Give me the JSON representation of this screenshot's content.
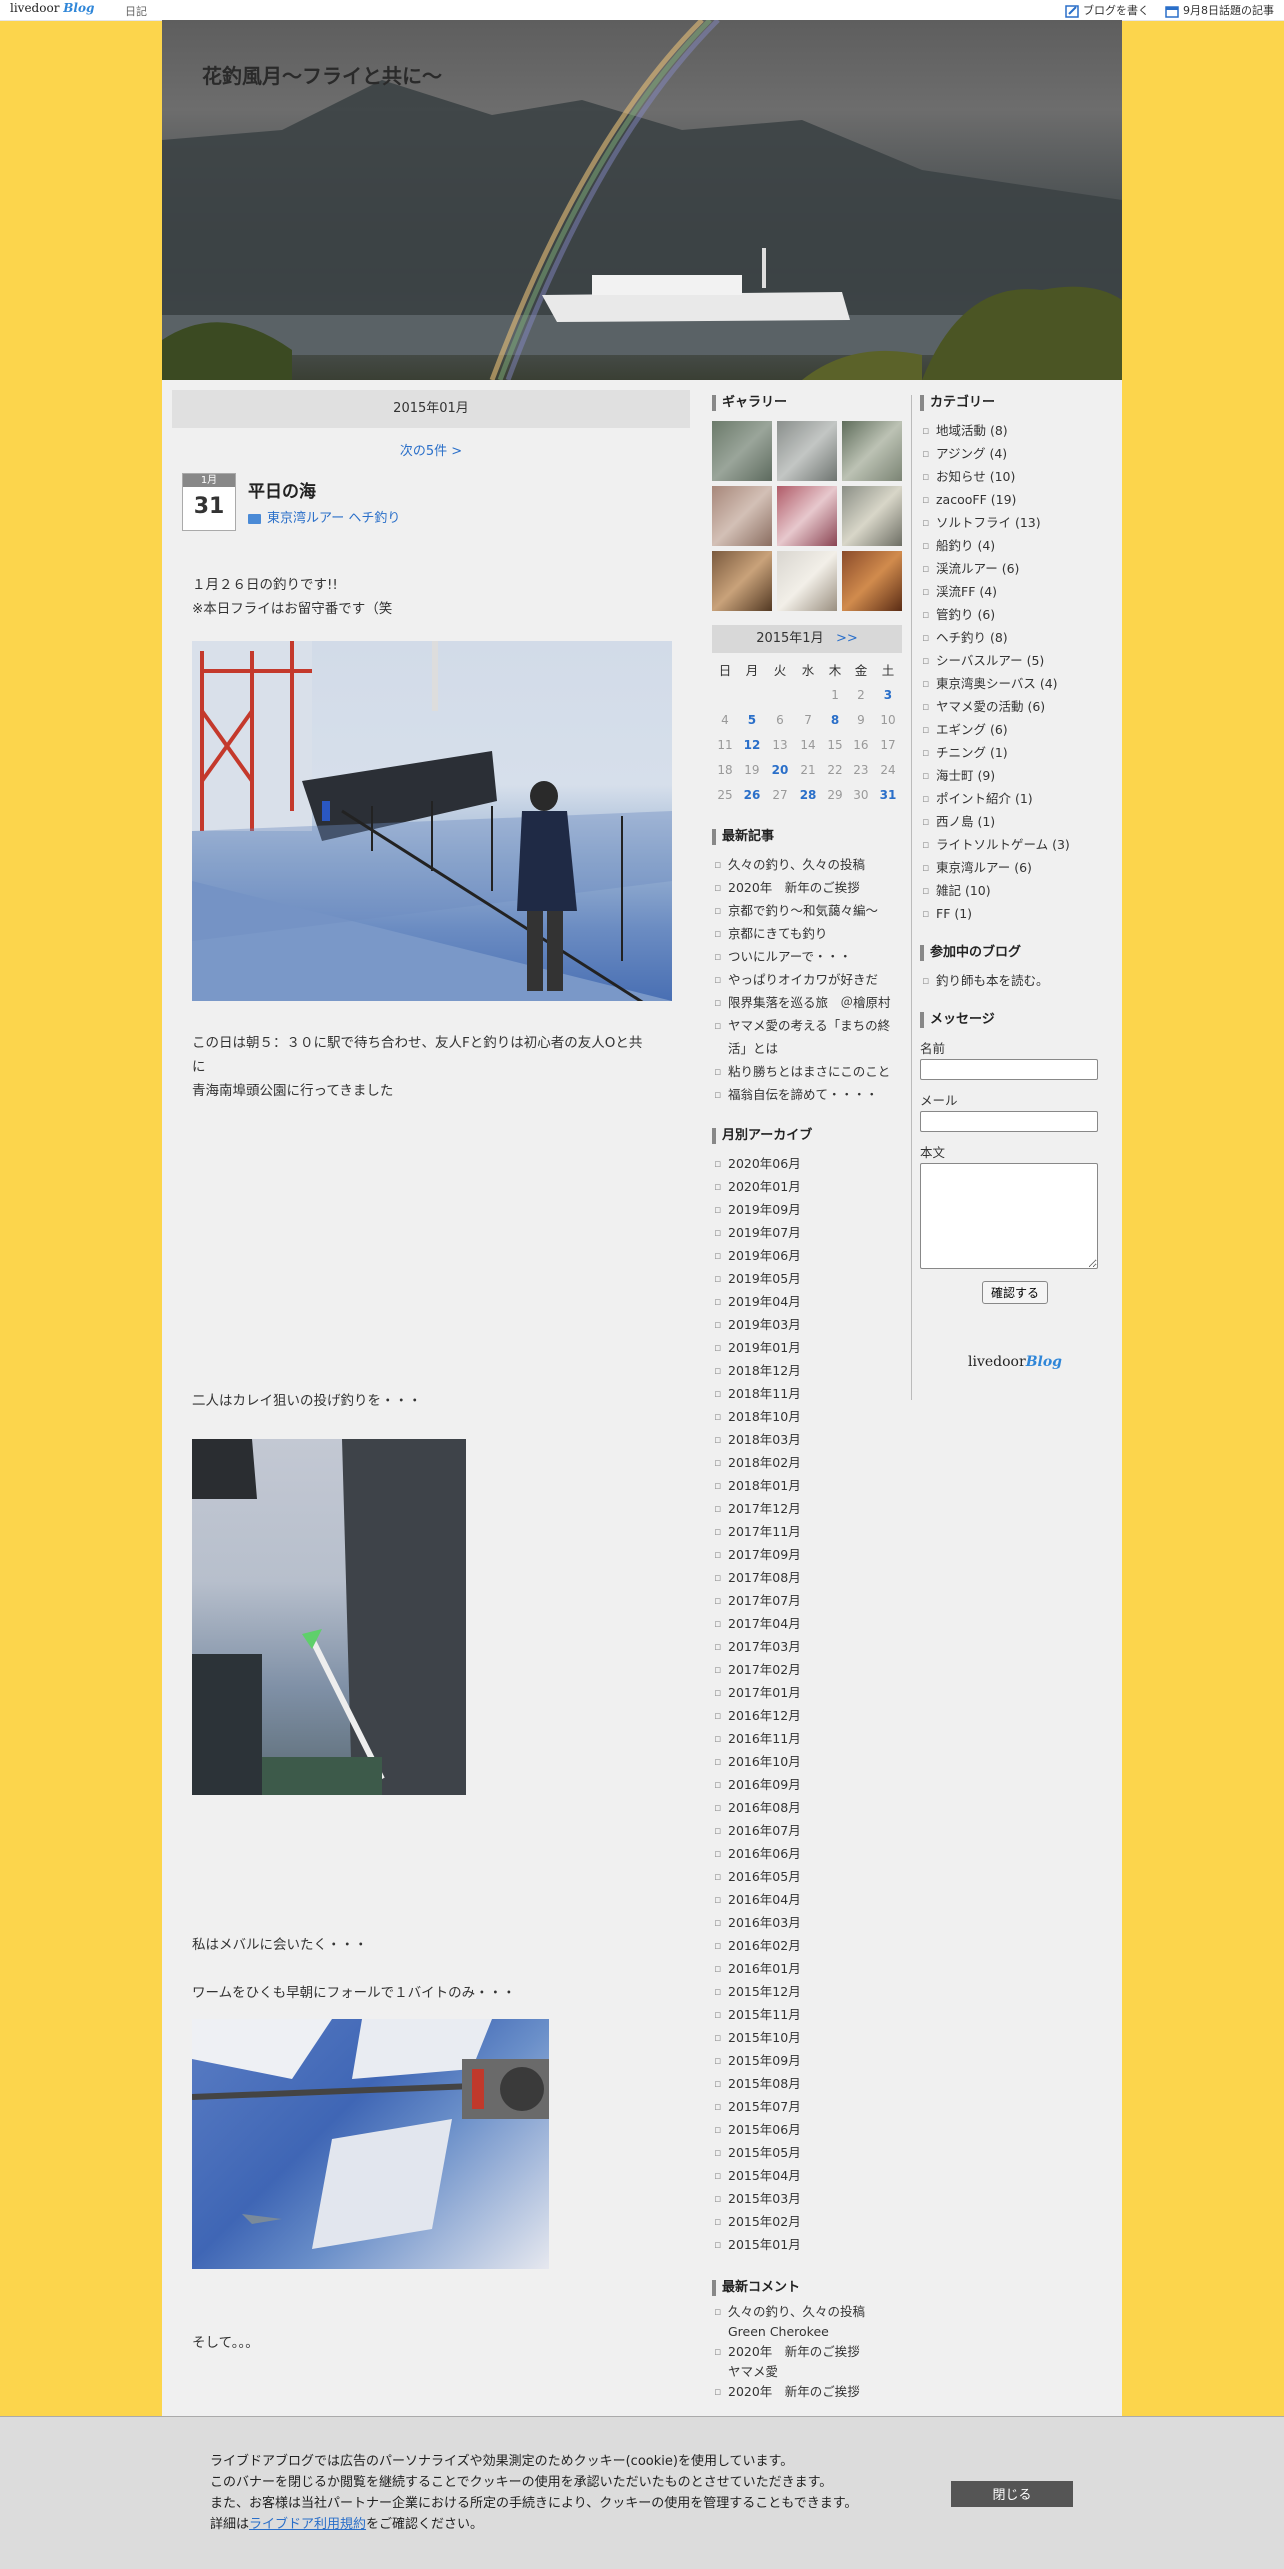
{
  "topbar": {
    "logo_text": "livedoor",
    "logo_blog": "Blog",
    "category": "日記",
    "write_blog": "ブログを書く",
    "topic": "9月8日話題の記事"
  },
  "header": {
    "title": "花釣風月～フライと共に～"
  },
  "main": {
    "date_heading": "2015年01月",
    "next_link": "次の5件 >",
    "entry": {
      "cal_month": "1月",
      "cal_day": "31",
      "title": "平日の海",
      "category": "東京湾ルアー ヘチ釣り",
      "p1_line1": "１月２６日の釣りです!!",
      "p1_line2": "※本日フライはお留守番です（笑",
      "p2_line1": "この日は朝５：３０に駅で待ち合わせ、友人Fと釣りは初心者の友人Oと共",
      "p2_line2": "に",
      "p2_line3": "青海南埠頭公園に行ってきました",
      "p3": "二人はカレイ狙いの投げ釣りを・・・",
      "p4": "私はメバルに会いたく・・・",
      "p5": "ワームをひくも早朝にフォールで１バイトのみ・・・",
      "p6": "そして。。。"
    }
  },
  "gallery": {
    "heading": "ギャラリー"
  },
  "calendar": {
    "header": "2015年1月",
    "next": ">>",
    "dow": [
      "日",
      "月",
      "火",
      "水",
      "木",
      "金",
      "土"
    ],
    "rows": [
      [
        "",
        "",
        "",
        "",
        "1",
        "2",
        "3"
      ],
      [
        "4",
        "5",
        "6",
        "7",
        "8",
        "9",
        "10"
      ],
      [
        "11",
        "12",
        "13",
        "14",
        "15",
        "16",
        "17"
      ],
      [
        "18",
        "19",
        "20",
        "21",
        "22",
        "23",
        "24"
      ],
      [
        "25",
        "26",
        "27",
        "28",
        "29",
        "30",
        "31"
      ]
    ],
    "links": [
      "3",
      "5",
      "8",
      "12",
      "20",
      "26",
      "28",
      "31"
    ]
  },
  "recent": {
    "heading": "最新記事",
    "items": [
      "久々の釣り、久々の投稿",
      "2020年　新年のご挨拶",
      "京都で釣り〜和気藹々編〜",
      "京都にきても釣り",
      "ついにルアーで・・・",
      "やっぱりオイカワが好きだ",
      "限界集落を巡る旅　＠檜原村",
      "ヤマメ愛の考える「まちの終活」とは",
      "粘り勝ちとはまさにこのこと",
      "福翁自伝を諦めて・・・・"
    ]
  },
  "archive": {
    "heading": "月別アーカイブ",
    "items": [
      "2020年06月",
      "2020年01月",
      "2019年09月",
      "2019年07月",
      "2019年06月",
      "2019年05月",
      "2019年04月",
      "2019年03月",
      "2019年01月",
      "2018年12月",
      "2018年11月",
      "2018年10月",
      "2018年03月",
      "2018年02月",
      "2018年01月",
      "2017年12月",
      "2017年11月",
      "2017年09月",
      "2017年08月",
      "2017年07月",
      "2017年04月",
      "2017年03月",
      "2017年02月",
      "2017年01月",
      "2016年12月",
      "2016年11月",
      "2016年10月",
      "2016年09月",
      "2016年08月",
      "2016年07月",
      "2016年06月",
      "2016年05月",
      "2016年04月",
      "2016年03月",
      "2016年02月",
      "2016年01月",
      "2015年12月",
      "2015年11月",
      "2015年10月",
      "2015年09月",
      "2015年08月",
      "2015年07月",
      "2015年06月",
      "2015年05月",
      "2015年04月",
      "2015年03月",
      "2015年02月",
      "2015年01月"
    ]
  },
  "comments": {
    "heading": "最新コメント",
    "items": [
      "久々の釣り、久々の投稿",
      "Green Cherokee",
      "2020年　新年のご挨拶",
      "ヤマメ愛",
      "2020年　新年のご挨拶"
    ]
  },
  "categories": {
    "heading": "カテゴリー",
    "items": [
      "地域活動 (8)",
      "アジング (4)",
      "お知らせ (10)",
      "zacooFF (19)",
      "ソルトフライ (13)",
      "船釣り (4)",
      "渓流ルアー (6)",
      "渓流FF (4)",
      "管釣り (6)",
      "ヘチ釣り (8)",
      "シーバスルアー (5)",
      "東京湾奥シーバス (4)",
      "ヤマメ愛の活動 (6)",
      "エギング (6)",
      "チニング (1)",
      "海士町 (9)",
      "ポイント紹介 (1)",
      "西ノ島 (1)",
      "ライトソルトゲーム (3)",
      "東京湾ルアー (6)",
      "雑記 (10)",
      "FF (1)"
    ]
  },
  "blogs": {
    "heading": "参加中のブログ",
    "items": [
      "釣り師も本を読む。"
    ]
  },
  "message": {
    "heading": "メッセージ",
    "name_label": "名前",
    "mail_label": "メール",
    "body_label": "本文",
    "confirm_button": "確認する"
  },
  "footer_logo": {
    "text": "livedoor",
    "blog": "Blog"
  },
  "cookie": {
    "line1": "ライブドアブログでは広告のパーソナライズや効果測定のためクッキー(cookie)を使用しています。",
    "line2": "このバナーを閉じるか閲覧を継続することでクッキーの使用を承認いただいたものとさせていただきます。",
    "line3": "また、お客様は当社パートナー企業における所定の手続きにより、クッキーの使用を管理することもできます。",
    "line4_prefix": "詳細は",
    "line4_link": "ライブドア利用規約",
    "line4_suffix": "をご確認ください。",
    "close": "閉じる"
  }
}
